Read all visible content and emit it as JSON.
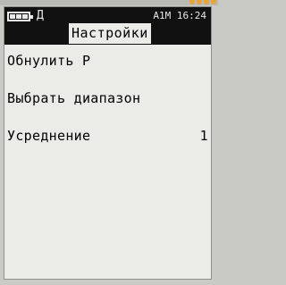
{
  "status": {
    "mode": "Д",
    "right": "A1M 16:24",
    "battery_icon": "battery-icon"
  },
  "title": "Настройки",
  "menu": {
    "items": [
      {
        "label": "Обнулить Р",
        "value": ""
      },
      {
        "label": "Выбрать диапазон",
        "value": ""
      },
      {
        "label": "Усреднение",
        "value": "1"
      }
    ]
  },
  "colors": {
    "screen_bg": "#ebebe8",
    "bar_bg": "#111111",
    "indicator": "#e8a43a"
  }
}
